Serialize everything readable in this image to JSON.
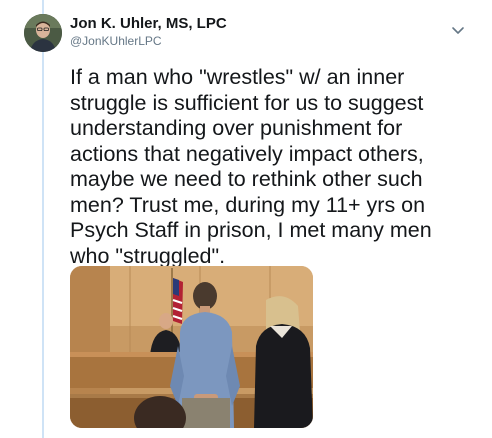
{
  "tweet": {
    "author_name": "Jon K. Uhler, MS, LPC",
    "author_handle": "@JonKUhlerLPC",
    "text": "If a man who \"wrestles\" w/ an inner\nstruggle is sufficient for us to suggest\nunderstanding over punishment for\nactions that negatively impact others,\nmaybe we need to rethink other such\nmen? Trust me, during my 11+ yrs on\nPsych Staff in prison, I met many men\nwho \"struggled\".",
    "media_description_icon": "courtroom-photo",
    "menu_icon": "chevron-down-icon"
  },
  "colors": {
    "text": "#14171a",
    "secondary": "#657786",
    "thread_line": "#cfe3f6"
  }
}
